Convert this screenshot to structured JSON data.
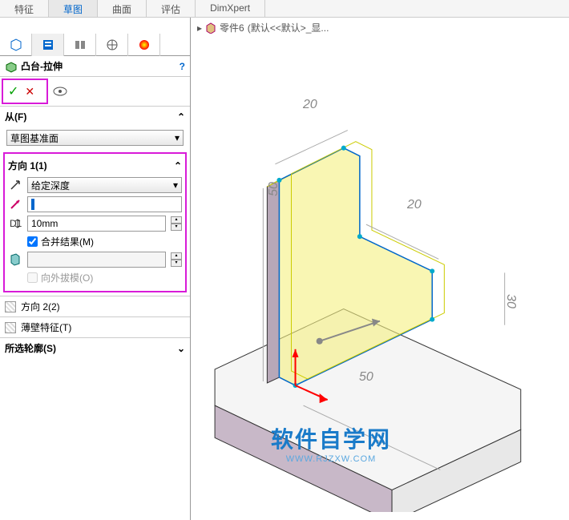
{
  "tabs": {
    "t1": "特征",
    "t2": "草图",
    "t3": "曲面",
    "t4": "评估",
    "t5": "DimXpert"
  },
  "breadcrumb": {
    "part": "零件6",
    "state": "(默认<<默认>_显..."
  },
  "feature": {
    "title": "凸台-拉伸"
  },
  "from": {
    "label": "从(F)",
    "plane": "草图基准面"
  },
  "dir1": {
    "label": "方向 1(1)",
    "endcond": "给定深度",
    "depth": "10mm",
    "merge": "合并结果(M)",
    "draft": "向外拔模(O)"
  },
  "dir2": {
    "label": "方向 2(2)"
  },
  "thin": {
    "label": "薄壁特征(T)"
  },
  "contour": {
    "label": "所选轮廓(S)"
  },
  "watermark": {
    "big": "软件自学网",
    "small": "WWW.RJZXW.COM"
  },
  "dims": {
    "d1": "20",
    "d2": "20",
    "d3": "50",
    "d4": "50",
    "d5": "30"
  }
}
